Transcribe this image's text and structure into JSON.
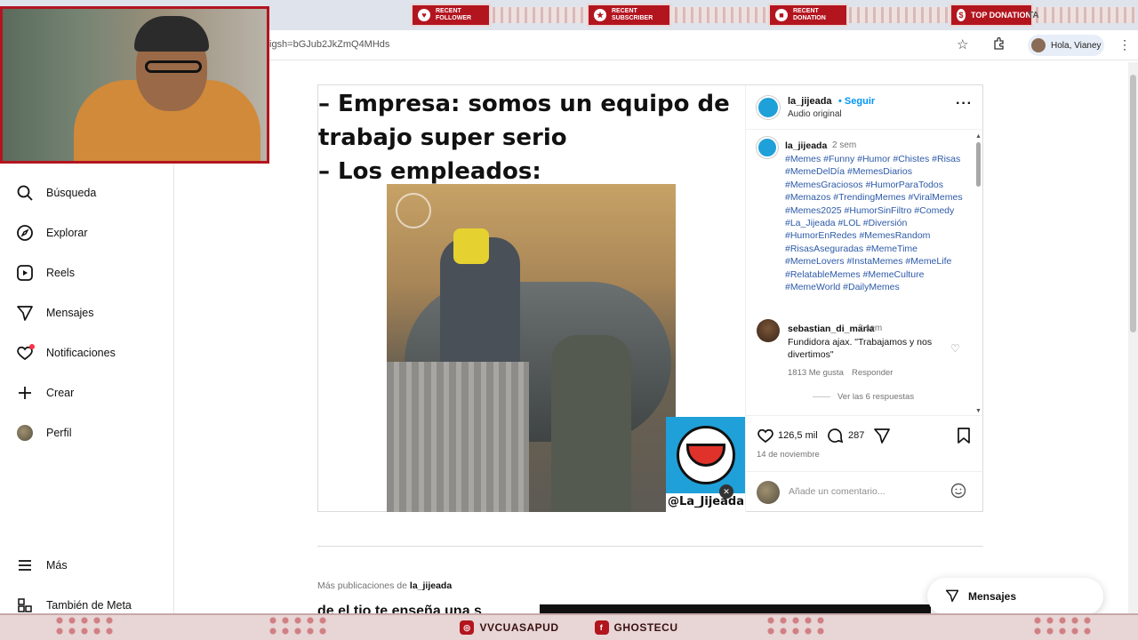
{
  "browser": {
    "url": "igsh=bGJub2JkZmQ4MHds",
    "profile_label": "Hola, Vianey"
  },
  "overlay": {
    "banners": [
      {
        "label": "RECENT FOLLOWER",
        "icon": "heart-icon"
      },
      {
        "label": "RECENT SUBSCRIBER",
        "icon": "trophy-icon"
      },
      {
        "label": "RECENT DONATION",
        "icon": "gift-icon"
      },
      {
        "label": "TOP DONATION",
        "icon": "money-bag-icon"
      }
    ],
    "top_donation_trail": "TA",
    "socials": [
      {
        "handle": "VVCUASAPUD",
        "icon": "instagram-icon"
      },
      {
        "handle": "GHOSTECU",
        "icon": "facebook-icon"
      }
    ]
  },
  "sidebar": {
    "items": [
      {
        "label": "Búsqueda",
        "icon": "search-icon"
      },
      {
        "label": "Explorar",
        "icon": "compass-icon"
      },
      {
        "label": "Reels",
        "icon": "reels-icon"
      },
      {
        "label": "Mensajes",
        "icon": "send-icon"
      },
      {
        "label": "Notificaciones",
        "icon": "heart-icon"
      },
      {
        "label": "Crear",
        "icon": "plus-icon"
      },
      {
        "label": "Perfil",
        "icon": "avatar-icon"
      }
    ],
    "footer": [
      {
        "label": "Más",
        "icon": "menu-icon"
      },
      {
        "label": "También de Meta",
        "icon": "meta-grid-icon"
      }
    ]
  },
  "post": {
    "caption_lines": [
      "– Empresa: somos un equipo de",
      "trabajo super serio",
      "– Los empleados:"
    ],
    "watermark_handle": "@La_Jijeada",
    "account": "la_jijeada",
    "follow_label": "Seguir",
    "audio": "Audio original",
    "caption_user": "la_jijeada",
    "caption_time": "2 sem",
    "hashtags": "#Memes #Funny #Humor #Chistes #Risas #MemeDelDía #MemesDiarios #MemesGraciosos #HumorParaTodos #Memazos #TrendingMemes #ViralMemes #Memes2025 #HumorSinFiltro #Comedy #La_Jijeada #LOL #Diversión #HumorEnRedes #MemesRandom #RisasAseguradas #MemeTime #MemeLovers #InstaMemes #MemeLife #RelatableMemes #MemeCulture #MemeWorld #DailyMemes",
    "comment": {
      "user": "sebastian_di_maria",
      "time": "2 sem",
      "text": "Fundidora ajax. \"Trabajamos y nos divertimos\"",
      "likes": "1813 Me gusta",
      "reply": "Responder",
      "view_replies": "Ver las 6 respuestas"
    },
    "likes": "126,5 mil",
    "comments_count": "287",
    "date": "14 de noviembre",
    "comment_placeholder": "Añade un comentario..."
  },
  "more_posts": {
    "prefix": "Más publicaciones de",
    "account": "la_jijeada",
    "next_caption_fragment": "de el tio te enseña una s"
  },
  "messages_pill": "Mensajes",
  "colors": {
    "link_blue": "#0095f6",
    "hashtag_blue": "#2d5aa8",
    "overlay_red": "#b3151f"
  }
}
